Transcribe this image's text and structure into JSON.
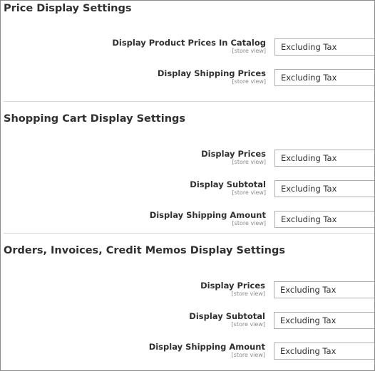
{
  "sections": [
    {
      "title": "Price Display Settings",
      "fields": [
        {
          "label": "Display Product Prices In Catalog",
          "scope": "[store view]",
          "value": "Excluding Tax"
        },
        {
          "label": "Display Shipping Prices",
          "scope": "[store view]",
          "value": "Excluding Tax"
        }
      ]
    },
    {
      "title": "Shopping Cart Display Settings",
      "fields": [
        {
          "label": "Display Prices",
          "scope": "[store view]",
          "value": "Excluding Tax"
        },
        {
          "label": "Display Subtotal",
          "scope": "[store view]",
          "value": "Excluding Tax"
        },
        {
          "label": "Display Shipping Amount",
          "scope": "[store view]",
          "value": "Excluding Tax"
        }
      ]
    },
    {
      "title": "Orders, Invoices, Credit Memos Display Settings",
      "fields": [
        {
          "label": "Display Prices",
          "scope": "[store view]",
          "value": "Excluding Tax"
        },
        {
          "label": "Display Subtotal",
          "scope": "[store view]",
          "value": "Excluding Tax"
        },
        {
          "label": "Display Shipping Amount",
          "scope": "[store view]",
          "value": "Excluding Tax"
        }
      ]
    }
  ]
}
